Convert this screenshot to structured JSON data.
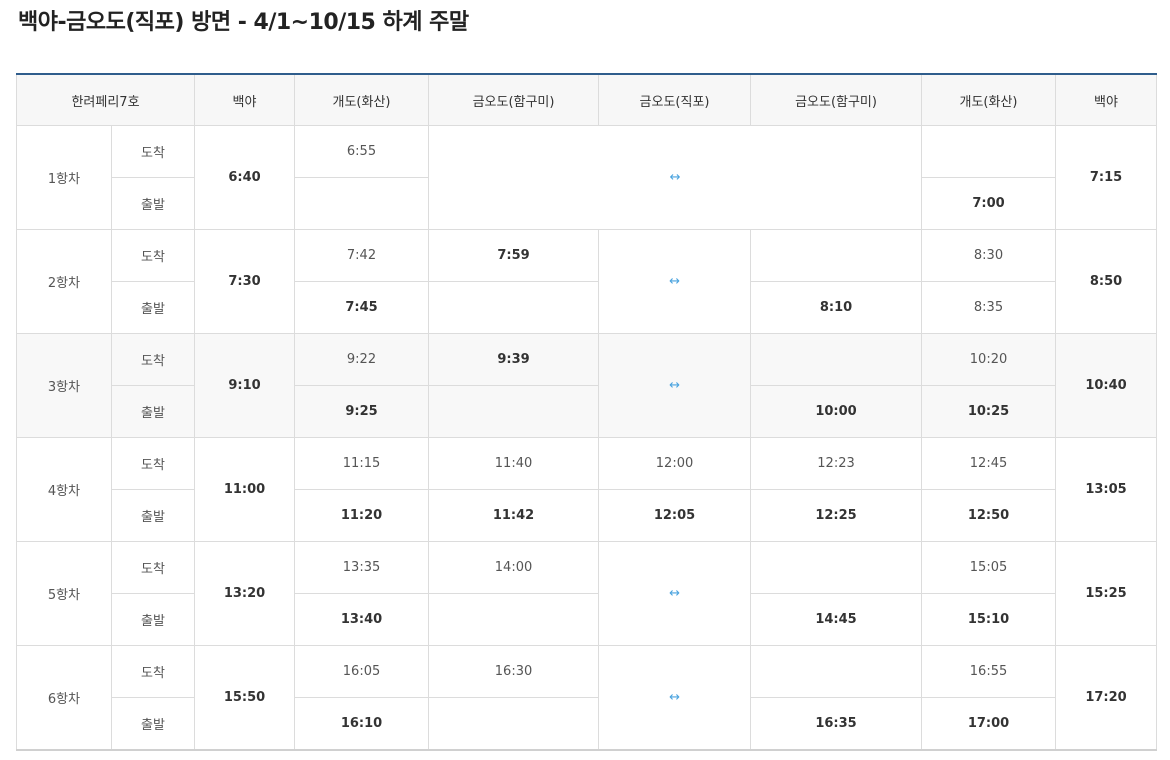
{
  "title": "백야-금오도(직포) 방면 - 4/1~10/15 하계 주말",
  "headers": [
    "한려페리7호",
    "백야",
    "개도(화산)",
    "금오도(함구미)",
    "금오도(직포)",
    "금오도(함구미)",
    "개도(화산)",
    "백야"
  ],
  "labels": {
    "arrive": "도착",
    "depart": "출발"
  },
  "arrow": "↔",
  "trips": [
    {
      "name": "1항차",
      "dep": "6:40",
      "a1": "6:55",
      "d1": "",
      "a2": "",
      "d2": "",
      "a3": "",
      "d3": "",
      "a4": "",
      "d4": "",
      "a5": "",
      "d5": "7:00",
      "arr": "7:15"
    },
    {
      "name": "2항차",
      "dep": "7:30",
      "a1": "7:42",
      "d1": "7:45",
      "a2": "7:59",
      "d2": "",
      "a4": "",
      "d4": "8:10",
      "a5": "8:30",
      "d5": "8:35",
      "arr": "8:50"
    },
    {
      "name": "3항차",
      "dep": "9:10",
      "a1": "9:22",
      "d1": "9:25",
      "a2": "9:39",
      "d2": "",
      "a4": "",
      "d4": "10:00",
      "a5": "10:20",
      "d5": "10:25",
      "arr": "10:40"
    },
    {
      "name": "4항차",
      "dep": "11:00",
      "a1": "11:15",
      "d1": "11:20",
      "a2": "11:40",
      "d2": "11:42",
      "a3": "12:00",
      "d3": "12:05",
      "a4": "12:23",
      "d4": "12:25",
      "a5": "12:45",
      "d5": "12:50",
      "arr": "13:05"
    },
    {
      "name": "5항차",
      "dep": "13:20",
      "a1": "13:35",
      "d1": "13:40",
      "a2": "14:00",
      "d2": "",
      "a4": "",
      "d4": "14:45",
      "a5": "15:05",
      "d5": "15:10",
      "arr": "15:25"
    },
    {
      "name": "6항차",
      "dep": "15:50",
      "a1": "16:05",
      "d1": "16:10",
      "a2": "16:30",
      "d2": "",
      "a4": "",
      "d4": "16:35",
      "a5": "16:55",
      "d5": "17:00",
      "arr": "17:20"
    }
  ],
  "colors": {
    "header_rule": "#2f5d8c",
    "arrow": "#4aa3df",
    "header_bg": "#f7f7f7",
    "grey_row": "#f8f8f8"
  }
}
